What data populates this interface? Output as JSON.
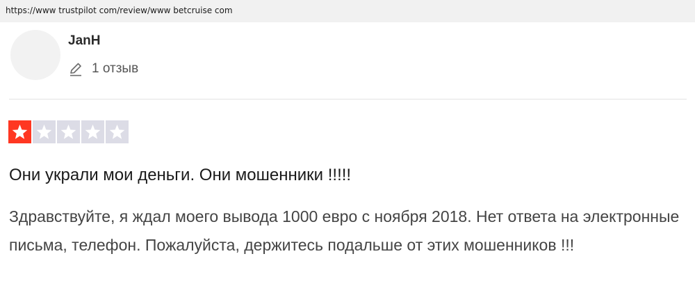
{
  "browser": {
    "url": "https://www trustpilot com/review/www betcruise com"
  },
  "reviewer": {
    "name": "JanH",
    "review_count": "1 отзыв",
    "review_count_icon": "pencil-icon",
    "avatar": "avatar-placeholder"
  },
  "review": {
    "rating": 1,
    "max_rating": 5,
    "star_active_color": "#ff3722",
    "star_inactive_color": "#dcdce6",
    "title": "Они украли мои деньги. Они мошенники !!!!!",
    "body": "Здравствуйте, я ждал моего вывода 1000 евро с ноября 2018. Нет ответа на электронные письма, телефон. Пожалуйста, держитесь подальше от этих мошенников !!!"
  }
}
